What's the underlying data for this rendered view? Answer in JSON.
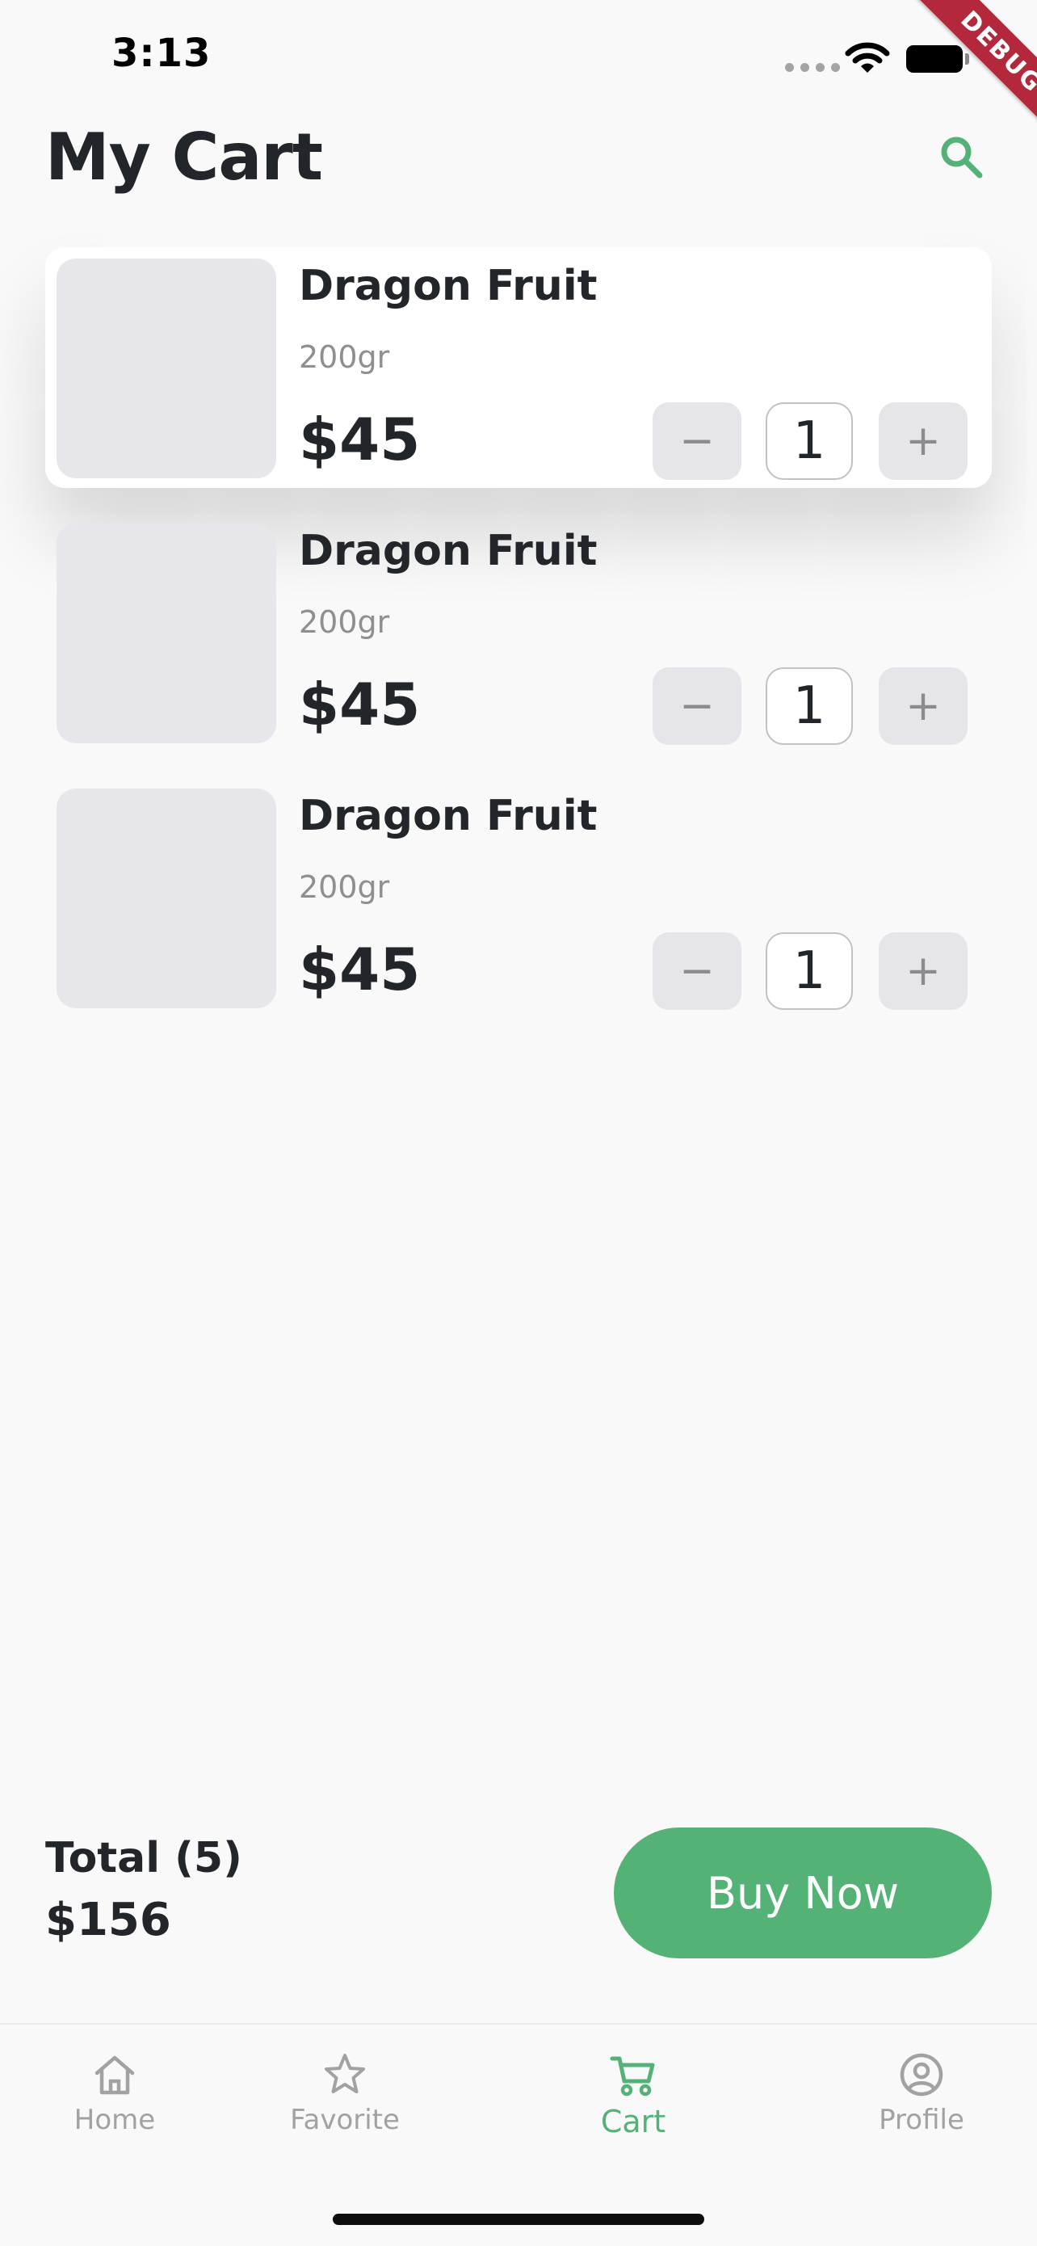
{
  "status_bar": {
    "time": "3:13"
  },
  "debug_banner": "DEBUG",
  "header": {
    "title": "My Cart",
    "search_icon": "search-icon"
  },
  "cart": {
    "items": [
      {
        "name": "Dragon Fruit",
        "weight": "200gr",
        "price": "$45",
        "quantity": "1",
        "minus": "−",
        "plus": "+"
      },
      {
        "name": "Dragon Fruit",
        "weight": "200gr",
        "price": "$45",
        "quantity": "1",
        "minus": "−",
        "plus": "+"
      },
      {
        "name": "Dragon Fruit",
        "weight": "200gr",
        "price": "$45",
        "quantity": "1",
        "minus": "−",
        "plus": "+"
      }
    ]
  },
  "summary": {
    "total_label": "Total (5)",
    "total_amount": "$156",
    "buy_label": "Buy Now"
  },
  "bottom_nav": {
    "items": [
      {
        "label": "Home",
        "icon": "home-icon"
      },
      {
        "label": "Favorite",
        "icon": "star-icon"
      },
      {
        "label": "Cart",
        "icon": "cart-icon",
        "active": true
      },
      {
        "label": "Profile",
        "icon": "profile-icon"
      }
    ]
  },
  "colors": {
    "accent": "#55b277",
    "text": "#22252a",
    "muted": "#8f8f8f",
    "background": "#f9f9f9",
    "placeholder": "#e7e6ea",
    "debug": "#b3283a"
  }
}
